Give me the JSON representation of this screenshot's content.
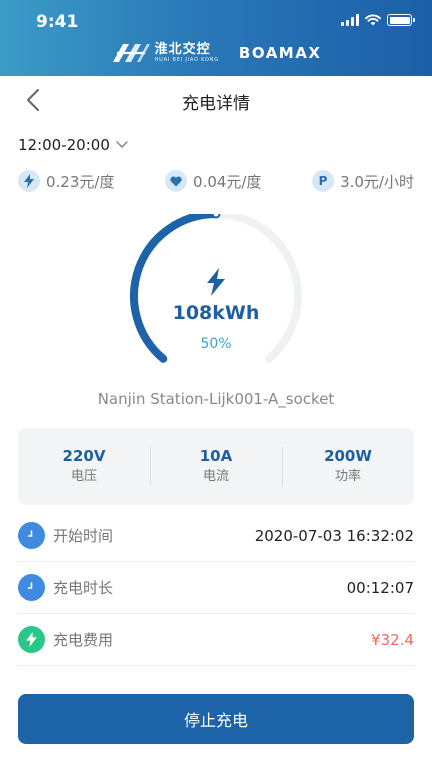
{
  "status_bar": {
    "time": "9:41"
  },
  "brand": {
    "left_name": "淮北交控",
    "left_sub": "HUAI BEI JIAO KONG",
    "right_name": "BOAMAX"
  },
  "nav": {
    "title": "充电详情"
  },
  "time_range": {
    "value": "12:00-20:00"
  },
  "prices": [
    {
      "icon": "bolt-icon",
      "text": "0.23元/度"
    },
    {
      "icon": "heart-icon",
      "text": "0.04元/度"
    },
    {
      "icon": "parking-icon",
      "text": "P",
      "value": "3.0元/小时"
    }
  ],
  "gauge": {
    "energy": "108kWh",
    "percent_label": "50%",
    "progress": 0.5,
    "color": "#1d63a8"
  },
  "station": {
    "name": "Nanjin Station-Lijk001-A_socket"
  },
  "stats": [
    {
      "value": "220V",
      "label": "电压"
    },
    {
      "value": "10A",
      "label": "电流"
    },
    {
      "value": "200W",
      "label": "功率"
    }
  ],
  "info": [
    {
      "label": "开始时间",
      "value": "2020-07-03 16:32:02"
    },
    {
      "label": "充电时长",
      "value": "00:12:07"
    },
    {
      "label": "充电费用",
      "value": "¥32.4"
    }
  ],
  "action": {
    "stop_label": "停止充电"
  },
  "colors": {
    "accent": "#1d63a8",
    "fee": "#f06b5a",
    "green": "#2bc78a",
    "blue_icon": "#3f8be0"
  }
}
